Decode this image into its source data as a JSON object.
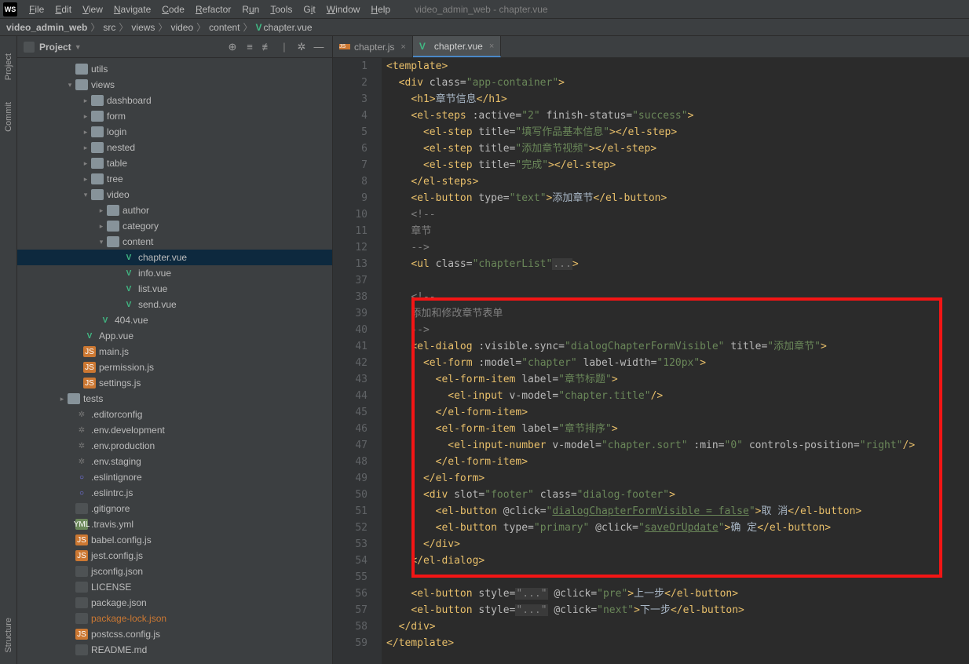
{
  "menubar": {
    "logo": "WS",
    "items": [
      "File",
      "Edit",
      "View",
      "Navigate",
      "Code",
      "Refactor",
      "Run",
      "Tools",
      "Git",
      "Window",
      "Help"
    ],
    "title": "video_admin_web - chapter.vue"
  },
  "breadcrumb": [
    "video_admin_web",
    "src",
    "views",
    "video",
    "content",
    "chapter.vue"
  ],
  "leftGutter": {
    "project": "Project",
    "commit": "Commit",
    "structure": "Structure"
  },
  "sidebar": {
    "header": {
      "label": "Project"
    },
    "tree": [
      {
        "indent": 62,
        "arrow": "none",
        "icon": "folder",
        "label": "utils"
      },
      {
        "indent": 62,
        "arrow": "open",
        "icon": "folder",
        "label": "views"
      },
      {
        "indent": 82,
        "arrow": "closed",
        "icon": "folder",
        "label": "dashboard"
      },
      {
        "indent": 82,
        "arrow": "closed",
        "icon": "folder",
        "label": "form"
      },
      {
        "indent": 82,
        "arrow": "closed",
        "icon": "folder",
        "label": "login"
      },
      {
        "indent": 82,
        "arrow": "closed",
        "icon": "folder",
        "label": "nested"
      },
      {
        "indent": 82,
        "arrow": "closed",
        "icon": "folder",
        "label": "table"
      },
      {
        "indent": 82,
        "arrow": "closed",
        "icon": "folder",
        "label": "tree"
      },
      {
        "indent": 82,
        "arrow": "open",
        "icon": "folder",
        "label": "video"
      },
      {
        "indent": 102,
        "arrow": "closed",
        "icon": "folder",
        "label": "author"
      },
      {
        "indent": 102,
        "arrow": "closed",
        "icon": "folder",
        "label": "category"
      },
      {
        "indent": 102,
        "arrow": "open",
        "icon": "folder",
        "label": "content"
      },
      {
        "indent": 122,
        "arrow": "none",
        "icon": "vue",
        "label": "chapter.vue",
        "selected": true
      },
      {
        "indent": 122,
        "arrow": "none",
        "icon": "vue",
        "label": "info.vue"
      },
      {
        "indent": 122,
        "arrow": "none",
        "icon": "vue",
        "label": "list.vue"
      },
      {
        "indent": 122,
        "arrow": "none",
        "icon": "vue",
        "label": "send.vue"
      },
      {
        "indent": 92,
        "arrow": "none",
        "icon": "vue",
        "label": "404.vue"
      },
      {
        "indent": 72,
        "arrow": "none",
        "icon": "vue",
        "label": "App.vue"
      },
      {
        "indent": 72,
        "arrow": "none",
        "icon": "js",
        "label": "main.js"
      },
      {
        "indent": 72,
        "arrow": "none",
        "icon": "js",
        "label": "permission.js"
      },
      {
        "indent": 72,
        "arrow": "none",
        "icon": "js",
        "label": "settings.js"
      },
      {
        "indent": 52,
        "arrow": "closed",
        "icon": "folder",
        "label": "tests"
      },
      {
        "indent": 62,
        "arrow": "none",
        "icon": "gear",
        "label": ".editorconfig"
      },
      {
        "indent": 62,
        "arrow": "none",
        "icon": "gear",
        "label": ".env.development"
      },
      {
        "indent": 62,
        "arrow": "none",
        "icon": "gear",
        "label": ".env.production"
      },
      {
        "indent": 62,
        "arrow": "none",
        "icon": "gear",
        "label": ".env.staging"
      },
      {
        "indent": 62,
        "arrow": "none",
        "icon": "eslint",
        "label": ".eslintignore"
      },
      {
        "indent": 62,
        "arrow": "none",
        "icon": "eslint",
        "label": ".eslintrc.js"
      },
      {
        "indent": 62,
        "arrow": "none",
        "icon": "txt",
        "label": ".gitignore"
      },
      {
        "indent": 62,
        "arrow": "none",
        "icon": "yml",
        "label": ".travis.yml"
      },
      {
        "indent": 62,
        "arrow": "none",
        "icon": "js",
        "label": "babel.config.js"
      },
      {
        "indent": 62,
        "arrow": "none",
        "icon": "js",
        "label": "jest.config.js"
      },
      {
        "indent": 62,
        "arrow": "none",
        "icon": "txt",
        "label": "jsconfig.json"
      },
      {
        "indent": 62,
        "arrow": "none",
        "icon": "txt",
        "label": "LICENSE"
      },
      {
        "indent": 62,
        "arrow": "none",
        "icon": "txt",
        "label": "package.json"
      },
      {
        "indent": 62,
        "arrow": "none",
        "icon": "txt",
        "label": "package-lock.json",
        "highlight": true
      },
      {
        "indent": 62,
        "arrow": "none",
        "icon": "js",
        "label": "postcss.config.js"
      },
      {
        "indent": 62,
        "arrow": "none",
        "icon": "txt",
        "label": "README.md"
      }
    ]
  },
  "tabs": [
    {
      "icon": "js",
      "label": "chapter.js",
      "active": false
    },
    {
      "icon": "vue",
      "label": "chapter.vue",
      "active": true
    }
  ],
  "gutter": [
    "1",
    "2",
    "3",
    "4",
    "5",
    "6",
    "7",
    "8",
    "9",
    "10",
    "11",
    "12",
    "13",
    "37",
    "38",
    "39",
    "40",
    "41",
    "42",
    "43",
    "44",
    "45",
    "46",
    "47",
    "48",
    "49",
    "50",
    "51",
    "52",
    "53",
    "54",
    "55",
    "56",
    "57",
    "58",
    "59"
  ],
  "code": {
    "l1": {
      "t": "<template>"
    },
    "l2": {
      "t": "<div",
      "a": " class=",
      "s": "\"app-container\"",
      "c": ">"
    },
    "l3": {
      "t1": "<h1>",
      "x": "章节信息",
      "t2": "</h1>"
    },
    "l4": {
      "t": "<el-steps",
      "a1": " :active=",
      "s1": "\"2\"",
      "a2": " finish-status=",
      "s2": "\"success\"",
      "c": ">"
    },
    "l5": {
      "t1": "<el-step",
      "a": " title=",
      "s": "\"填写作品基本信息\"",
      "t2": "></el-step>"
    },
    "l6": {
      "t1": "<el-step",
      "a": " title=",
      "s": "\"添加章节视频\"",
      "t2": "></el-step>"
    },
    "l7": {
      "t1": "<el-step",
      "a": " title=",
      "s": "\"完成\"",
      "t2": "></el-step>"
    },
    "l8": {
      "t": "</el-steps>"
    },
    "l9": {
      "t1": "<el-button",
      "a": " type=",
      "s": "\"text\"",
      "c": ">",
      "x": "添加章节",
      "t2": "</el-button>"
    },
    "l10": {
      "c": "<!--"
    },
    "l11": {
      "c": "章节"
    },
    "l12": {
      "c": "-->"
    },
    "l13": {
      "t": "<ul",
      "a": " class=",
      "s": "\"chapterList\"",
      "f": "...",
      "c": ">"
    },
    "l38": {
      "c": "<!--"
    },
    "l39": {
      "c": "添加和修改章节表单"
    },
    "l40": {
      "c": "-->"
    },
    "l41": {
      "t": "<el-dialog",
      "a1": " :visible.sync=",
      "s1": "\"dialogChapterFormVisible\"",
      "a2": " title=",
      "s2": "\"添加章节\"",
      "c": ">"
    },
    "l42": {
      "t": "<el-form",
      "a1": " :model=",
      "s1": "\"chapter\"",
      "a2": " label-width=",
      "s2": "\"120px\"",
      "c": ">"
    },
    "l43": {
      "t": "<el-form-item",
      "a": " label=",
      "s": "\"章节标题\"",
      "c": ">"
    },
    "l44": {
      "t": "<el-input",
      "a": " v-model=",
      "s": "\"chapter.title\"",
      "c": "/>"
    },
    "l45": {
      "t": "</el-form-item>"
    },
    "l46": {
      "t": "<el-form-item",
      "a": " label=",
      "s": "\"章节排序\"",
      "c": ">"
    },
    "l47": {
      "t": "<el-input-number",
      "a1": " v-model=",
      "s1": "\"chapter.sort\"",
      "a2": " :min=",
      "s2": "\"0\"",
      "a3": " controls-position=",
      "s3": "\"right\"",
      "c": "/>"
    },
    "l48": {
      "t": "</el-form-item>"
    },
    "l49": {
      "t": "</el-form>"
    },
    "l50": {
      "t": "<div",
      "a1": " slot=",
      "s1": "\"footer\"",
      "a2": " class=",
      "s2": "\"dialog-footer\"",
      "c": ">"
    },
    "l51": {
      "t1": "<el-button",
      "a": " @click=",
      "s1": "\"",
      "u": "dialogChapterFormVisible = false",
      "s2": "\"",
      "c": ">",
      "x": "取 消",
      "t2": "</el-button>"
    },
    "l52": {
      "t1": "<el-button",
      "a1": " type=",
      "s1": "\"primary\"",
      "a2": " @click=",
      "s2": "\"",
      "u": "saveOrUpdate",
      "s3": "\"",
      "c": ">",
      "x": "确 定",
      "t2": "</el-button>"
    },
    "l53": {
      "t": "</div>"
    },
    "l54": {
      "t": "</el-dialog>"
    },
    "l56": {
      "t1": "<el-button",
      "a1": " style=",
      "f": "\"...\"",
      "a2": " @click=",
      "s": "\"pre\"",
      "c": ">",
      "x": "上一步",
      "t2": "</el-button>"
    },
    "l57": {
      "t1": "<el-button",
      "a1": " style=",
      "f": "\"...\"",
      "a2": " @click=",
      "s": "\"next\"",
      "c": ">",
      "x": "下一步",
      "t2": "</el-button>"
    },
    "l58": {
      "t": "</div>"
    },
    "l59": {
      "t": "</template>"
    }
  }
}
